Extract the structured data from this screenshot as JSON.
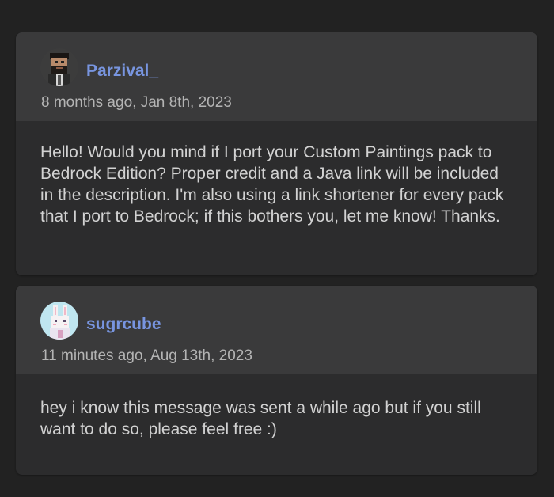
{
  "comments": [
    {
      "username": "Parzival_",
      "timestamp": "8 months ago, Jan 8th, 2023",
      "text": "Hello! Would you mind if I port your Custom Paintings pack to Bedrock Edition? Proper credit and a Java link will be included in the description. I'm also using a link shortener for every pack that I port to Bedrock; if this bothers you, let me know! Thanks.",
      "avatar": "pixel-art-bearded-man-avatar"
    },
    {
      "username": "sugrcube",
      "timestamp": "11 minutes ago, Aug 13th, 2023",
      "text": "hey i know this message was sent a while ago but if you still want to do so, please feel free :)",
      "avatar": "pixel-art-bunny-avatar"
    }
  ],
  "colors": {
    "page_background": "#222222",
    "card_background": "#2c2c2d",
    "header_background": "#3a3a3b",
    "username": "#7895e0",
    "timestamp": "#b4b4b4",
    "body_text": "#d2d2d2"
  }
}
